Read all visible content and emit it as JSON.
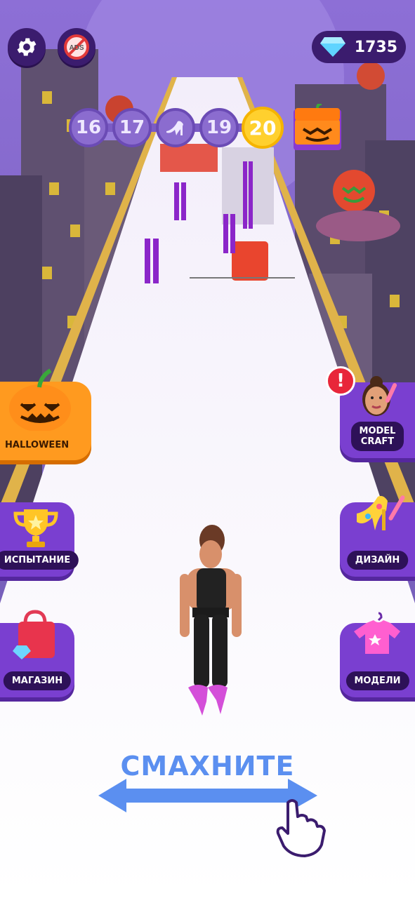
{
  "hud": {
    "settings_icon": "gear-icon",
    "no_ads_label": "ADS",
    "gems_icon": "diamond-icon",
    "gems_count": "1735"
  },
  "progress": {
    "levels": [
      "16",
      "17",
      "19"
    ],
    "boss_icon": "high-heel-icon",
    "current_level": "20",
    "reward_icon": "pumpkin-gift-icon"
  },
  "left_menu": {
    "halloween": "HALLOWEEN",
    "challenge": "ИСПЫТАНИЕ",
    "shop": "МАГАЗИН"
  },
  "right_menu": {
    "model_craft_line1": "MODEL",
    "model_craft_line2": "CRAFT",
    "model_craft_alert": "!",
    "design": "ДИЗАЙН",
    "models": "МОДЕЛИ"
  },
  "tutorial": {
    "swipe_text": "СМАХНИТЕ"
  },
  "colors": {
    "accent_purple": "#7a3fd0",
    "current_level_yellow": "#ffd02e",
    "swipe_blue": "#5b8ff0",
    "halloween_orange": "#ff9a1f"
  }
}
